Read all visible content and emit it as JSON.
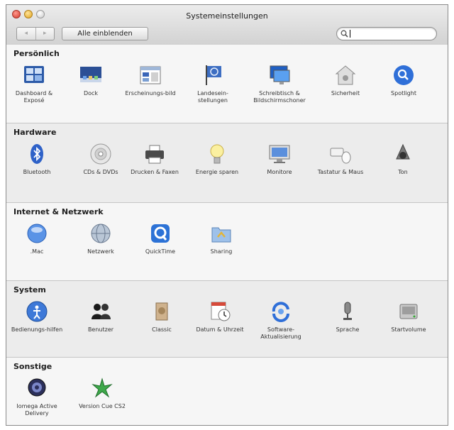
{
  "window": {
    "title": "Systemeinstellungen",
    "back_label": "◂",
    "forward_label": "▸",
    "show_all_label": "Alle einblenden",
    "search_value": ""
  },
  "colors": {
    "accent_blue": "#2f6fd8",
    "window_chrome": "#d8d8d8"
  },
  "sections": [
    {
      "title": "Persönlich",
      "items": [
        {
          "label": "Dashboard & Exposé",
          "icon": "dashboard-expose-icon"
        },
        {
          "label": "Dock",
          "icon": "dock-icon"
        },
        {
          "label": "Erscheinungs-bild",
          "icon": "appearance-icon"
        },
        {
          "label": "Landesein-stellungen",
          "icon": "international-flag-icon"
        },
        {
          "label": "Schreibtisch & Bildschirmschoner",
          "icon": "desktop-screensaver-icon"
        },
        {
          "label": "Sicherheit",
          "icon": "security-house-icon"
        },
        {
          "label": "Spotlight",
          "icon": "spotlight-icon"
        }
      ]
    },
    {
      "title": "Hardware",
      "items": [
        {
          "label": "Bluetooth",
          "icon": "bluetooth-icon"
        },
        {
          "label": "CDs & DVDs",
          "icon": "cd-dvd-icon"
        },
        {
          "label": "Drucken & Faxen",
          "icon": "printer-icon"
        },
        {
          "label": "Energie sparen",
          "icon": "lightbulb-icon"
        },
        {
          "label": "Monitore",
          "icon": "monitor-icon"
        },
        {
          "label": "Tastatur & Maus",
          "icon": "keyboard-mouse-icon"
        },
        {
          "label": "Ton",
          "icon": "speaker-icon"
        }
      ]
    },
    {
      "title": "Internet & Netzwerk",
      "items": [
        {
          "label": ".Mac",
          "icon": "dotmac-icon"
        },
        {
          "label": "Netzwerk",
          "icon": "network-globe-icon"
        },
        {
          "label": "QuickTime",
          "icon": "quicktime-icon"
        },
        {
          "label": "Sharing",
          "icon": "sharing-folder-icon"
        }
      ]
    },
    {
      "title": "System",
      "items": [
        {
          "label": "Bedienungs-hilfen",
          "icon": "accessibility-icon"
        },
        {
          "label": "Benutzer",
          "icon": "users-icon"
        },
        {
          "label": "Classic",
          "icon": "classic-icon"
        },
        {
          "label": "Datum & Uhrzeit",
          "icon": "date-time-icon"
        },
        {
          "label": "Software-Aktualisierung",
          "icon": "software-update-icon"
        },
        {
          "label": "Sprache",
          "icon": "speech-microphone-icon"
        },
        {
          "label": "Startvolume",
          "icon": "startup-disk-icon"
        }
      ]
    },
    {
      "title": "Sonstige",
      "items": [
        {
          "label": "Iomega Active Delivery",
          "icon": "iomega-icon"
        },
        {
          "label": "Version Cue CS2",
          "icon": "version-cue-icon"
        }
      ]
    }
  ]
}
